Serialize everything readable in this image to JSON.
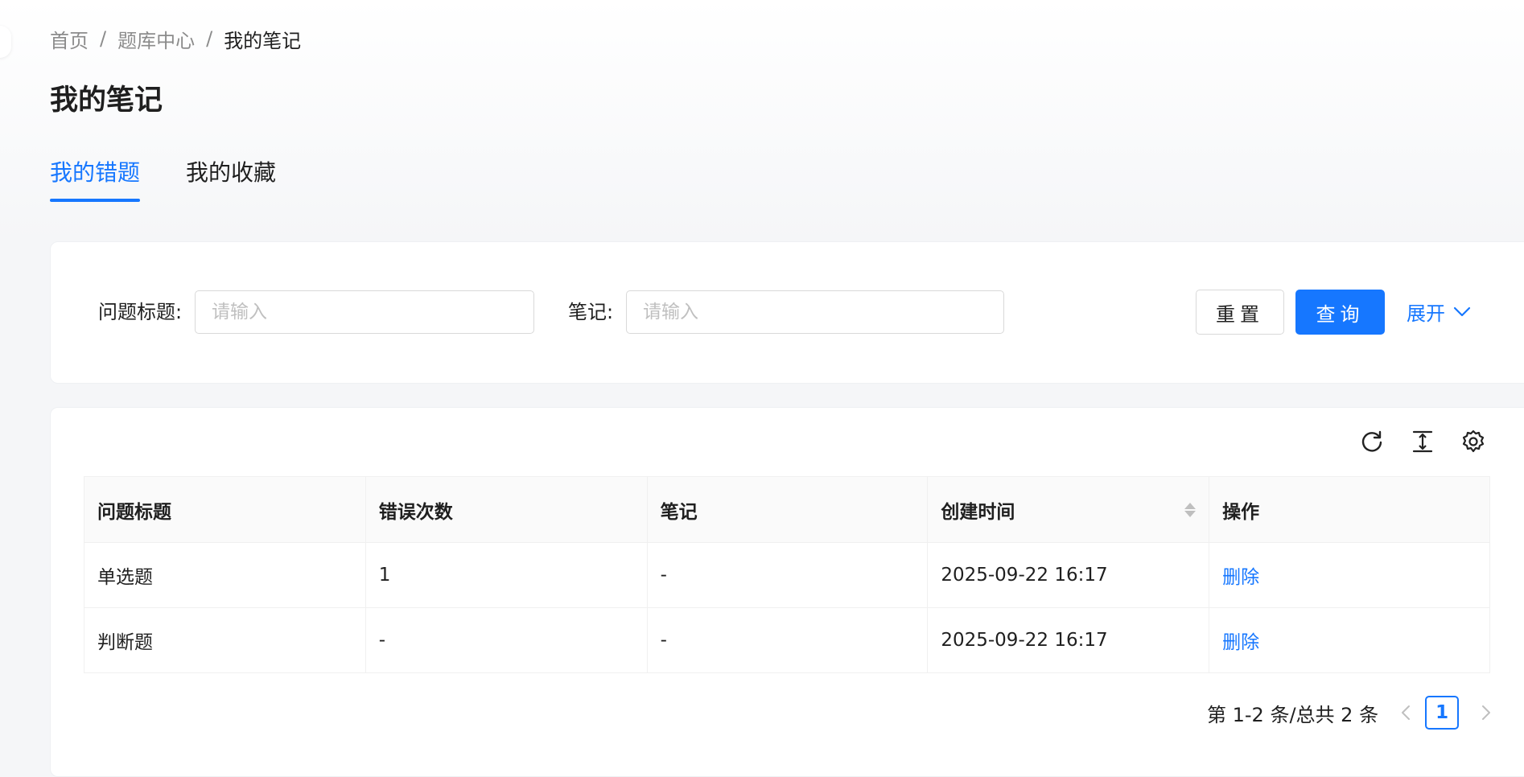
{
  "breadcrumb": {
    "home": "首页",
    "center": "题库中心",
    "current": "我的笔记",
    "separator": "/"
  },
  "page_title": "我的笔记",
  "tabs": [
    {
      "label": "我的错题",
      "active": true
    },
    {
      "label": "我的收藏",
      "active": false
    }
  ],
  "search": {
    "title_label": "问题标题:",
    "title_placeholder": "请输入",
    "note_label": "笔记:",
    "note_placeholder": "请输入",
    "reset_label": "重置",
    "query_label": "查询",
    "expand_label": "展开"
  },
  "toolbar": {
    "icons": [
      "reload-icon",
      "column-height-icon",
      "setting-icon"
    ]
  },
  "table": {
    "headers": [
      "问题标题",
      "错误次数",
      "笔记",
      "创建时间",
      "操作"
    ],
    "rows": [
      {
        "title": "单选题",
        "errors": "1",
        "note": "-",
        "created": "2025-09-22 16:17",
        "action": "删除"
      },
      {
        "title": "判断题",
        "errors": "-",
        "note": "-",
        "created": "2025-09-22 16:17",
        "action": "删除"
      }
    ]
  },
  "pagination": {
    "summary": "第 1-2 条/总共 2 条",
    "current_page": "1"
  },
  "colors": {
    "primary": "#1677ff"
  }
}
